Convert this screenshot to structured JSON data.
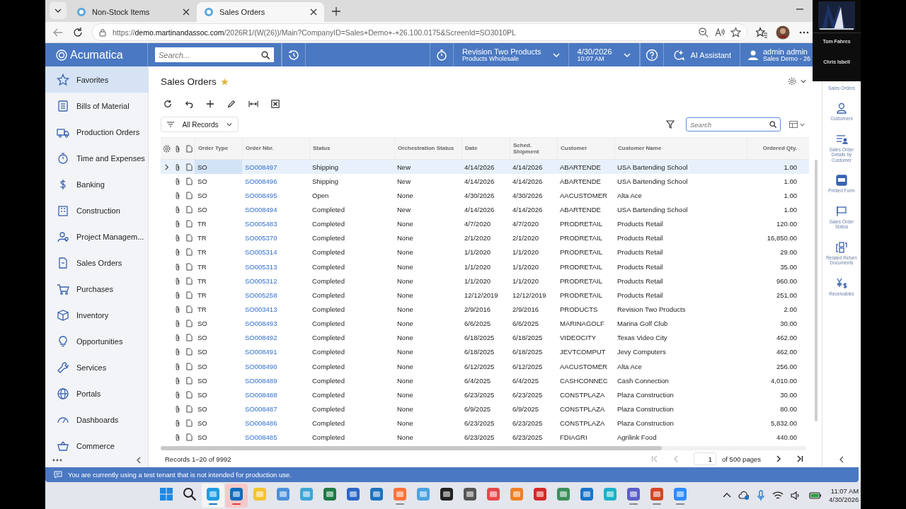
{
  "browser": {
    "tabs": [
      {
        "title": "Non-Stock Items",
        "selected": false
      },
      {
        "title": "Sales Orders",
        "selected": true
      }
    ],
    "url": "https://**demo.martinandassoc.com**/2026R1/(W(26))/Main?CompanyID=Sales+Demo+-+26.100.0175&ScreenId=SO3010PL"
  },
  "header": {
    "logo": "Acumatica",
    "search_placeholder": "Search...",
    "company": "Revision Two Products",
    "branch": "Products Wholesale",
    "date": "4/30/2026",
    "time": "10:07 AM",
    "assistant": "AI Assistant",
    "user": "admin admin",
    "tenant": "Sales Demo - 26"
  },
  "sidebar": {
    "items": [
      {
        "label": "Favorites",
        "selected": true
      },
      {
        "label": "Bills of Material",
        "selected": false
      },
      {
        "label": "Production Orders",
        "selected": false
      },
      {
        "label": "Time and Expenses",
        "selected": false
      },
      {
        "label": "Banking",
        "selected": false
      },
      {
        "label": "Construction",
        "selected": false
      },
      {
        "label": "Project Managem...",
        "selected": false
      },
      {
        "label": "Sales Orders",
        "selected": false
      },
      {
        "label": "Purchases",
        "selected": false
      },
      {
        "label": "Inventory",
        "selected": false
      },
      {
        "label": "Opportunities",
        "selected": false
      },
      {
        "label": "Services",
        "selected": false
      },
      {
        "label": "Portals",
        "selected": false
      },
      {
        "label": "Dashboards",
        "selected": false
      },
      {
        "label": "Commerce",
        "selected": false
      }
    ]
  },
  "page": {
    "title": "Sales Orders",
    "favorite": true,
    "filter": "All Records",
    "search_placeholder": "Search"
  },
  "table": {
    "columns": [
      "Order Type",
      "Order Nbr.",
      "Status",
      "Orchestration Status",
      "Date",
      "Sched. Shipment",
      "Customer",
      "Customer Name",
      "Ordered Qty."
    ],
    "rows": [
      {
        "expandable": true,
        "selected": true,
        "cells": [
          "SO",
          "SO008497",
          "Shipping",
          "New",
          "4/14/2026",
          "4/14/2026",
          "ABARTENDE",
          "USA Bartending School",
          "1.00"
        ]
      },
      {
        "expandable": false,
        "selected": false,
        "cells": [
          "SO",
          "SO008496",
          "Shipping",
          "New",
          "4/14/2026",
          "4/14/2026",
          "ABARTENDE",
          "USA Bartending School",
          "1.00"
        ]
      },
      {
        "expandable": false,
        "selected": false,
        "cells": [
          "SO",
          "SO008495",
          "Open",
          "None",
          "4/30/2026",
          "4/30/2026",
          "AACUSTOMER",
          "Alta Ace",
          "1.00"
        ]
      },
      {
        "expandable": false,
        "selected": false,
        "cells": [
          "SO",
          "SO008494",
          "Completed",
          "New",
          "4/14/2026",
          "4/14/2026",
          "ABARTENDE",
          "USA Bartending School",
          "1.00"
        ]
      },
      {
        "expandable": false,
        "selected": false,
        "cells": [
          "TR",
          "SO005483",
          "Completed",
          "None",
          "4/7/2020",
          "4/7/2020",
          "PRODRETAIL",
          "Products Retail",
          "120.00"
        ]
      },
      {
        "expandable": false,
        "selected": false,
        "cells": [
          "TR",
          "SO005370",
          "Completed",
          "None",
          "2/1/2020",
          "2/1/2020",
          "PRODRETAIL",
          "Products Retail",
          "16,850.00"
        ]
      },
      {
        "expandable": false,
        "selected": false,
        "cells": [
          "TR",
          "SO005314",
          "Completed",
          "None",
          "1/1/2020",
          "1/1/2020",
          "PRODRETAIL",
          "Products Retail",
          "29.00"
        ]
      },
      {
        "expandable": false,
        "selected": false,
        "cells": [
          "TR",
          "SO005313",
          "Completed",
          "None",
          "1/1/2020",
          "1/1/2020",
          "PRODRETAIL",
          "Products Retail",
          "35.00"
        ]
      },
      {
        "expandable": false,
        "selected": false,
        "cells": [
          "TR",
          "SO005312",
          "Completed",
          "None",
          "1/1/2020",
          "1/1/2020",
          "PRODRETAIL",
          "Products Retail",
          "960.00"
        ]
      },
      {
        "expandable": false,
        "selected": false,
        "cells": [
          "TR",
          "SO005258",
          "Completed",
          "None",
          "12/12/2019",
          "12/12/2019",
          "PRODRETAIL",
          "Products Retail",
          "251.00"
        ]
      },
      {
        "expandable": false,
        "selected": false,
        "cells": [
          "TR",
          "SO003413",
          "Completed",
          "None",
          "2/9/2016",
          "2/9/2016",
          "PRODUCTS",
          "Revision Two Products",
          "2.00"
        ]
      },
      {
        "expandable": false,
        "selected": false,
        "cells": [
          "SO",
          "SO008493",
          "Completed",
          "None",
          "6/6/2025",
          "6/6/2025",
          "MARINAGOLF",
          "Marina Golf Club",
          "30.00"
        ]
      },
      {
        "expandable": false,
        "selected": false,
        "cells": [
          "SO",
          "SO008492",
          "Completed",
          "None",
          "6/18/2025",
          "6/18/2025",
          "VIDEOCITY",
          "Texas Video City",
          "462.00"
        ]
      },
      {
        "expandable": false,
        "selected": false,
        "cells": [
          "SO",
          "SO008491",
          "Completed",
          "None",
          "6/18/2025",
          "6/18/2025",
          "JEVTCOMPUT",
          "Jevy Computers",
          "462.00"
        ]
      },
      {
        "expandable": false,
        "selected": false,
        "cells": [
          "SO",
          "SO008490",
          "Completed",
          "None",
          "6/12/2025",
          "6/12/2025",
          "AACUSTOMER",
          "Alta Ace",
          "256.00"
        ]
      },
      {
        "expandable": false,
        "selected": false,
        "cells": [
          "SO",
          "SO008489",
          "Completed",
          "None",
          "6/4/2025",
          "6/4/2025",
          "CASHCONNEC",
          "Cash Connection",
          "4,010.00"
        ]
      },
      {
        "expandable": false,
        "selected": false,
        "cells": [
          "SO",
          "SO008488",
          "Completed",
          "None",
          "6/23/2025",
          "6/23/2025",
          "CONSTPLAZA",
          "Plaza Construction",
          "30.00"
        ]
      },
      {
        "expandable": false,
        "selected": false,
        "cells": [
          "SO",
          "SO008487",
          "Completed",
          "None",
          "6/9/2025",
          "6/9/2025",
          "CONSTPLAZA",
          "Plaza Construction",
          "80.00"
        ]
      },
      {
        "expandable": false,
        "selected": false,
        "cells": [
          "SO",
          "SO008486",
          "Completed",
          "None",
          "6/23/2025",
          "6/23/2025",
          "CONSTPLAZA",
          "Plaza Construction",
          "5,832.00"
        ]
      },
      {
        "expandable": false,
        "selected": false,
        "cells": [
          "SO",
          "SO008485",
          "Completed",
          "None",
          "6/23/2025",
          "6/23/2025",
          "FDIAGRI",
          "Agrilink Food",
          "440.00"
        ]
      }
    ]
  },
  "footer": {
    "records": "Records 1–20 of 9992",
    "page": "1",
    "pages": "of 500 pages"
  },
  "related": {
    "items": [
      "Sales Orders",
      "Customers",
      "Sales Order Details by Customer",
      "Printed Form",
      "Sales Order Status",
      "Related Return Documents",
      "Receivables"
    ]
  },
  "notice": "You are currently using a test tenant that is not intended for production use.",
  "taskbar": {
    "apps": [
      {
        "kind": "windows",
        "color": "#1e88e5",
        "selected": false,
        "attention": false,
        "running": false
      },
      {
        "kind": "search",
        "color": "#222222",
        "selected": false,
        "attention": false,
        "running": false
      },
      {
        "kind": "app",
        "color": "#1b9de2",
        "selected": true,
        "attention": false,
        "running": true
      },
      {
        "kind": "app",
        "color": "#0f6cbd",
        "selected": false,
        "attention": true,
        "running": true
      },
      {
        "kind": "app",
        "color": "#f4c430",
        "selected": false,
        "attention": false,
        "running": false
      },
      {
        "kind": "app",
        "color": "#4a90d9",
        "selected": false,
        "attention": false,
        "running": false
      },
      {
        "kind": "app",
        "color": "#3ea6d8",
        "selected": false,
        "attention": false,
        "running": false
      },
      {
        "kind": "app",
        "color": "#1d7a45",
        "selected": false,
        "attention": false,
        "running": false
      },
      {
        "kind": "app",
        "color": "#2b66c8",
        "selected": false,
        "attention": false,
        "running": false
      },
      {
        "kind": "app",
        "color": "#1e73be",
        "selected": false,
        "attention": false,
        "running": false
      },
      {
        "kind": "app",
        "color": "#ff7139",
        "selected": false,
        "attention": false,
        "running": true
      },
      {
        "kind": "app",
        "color": "#4aa3df",
        "selected": false,
        "attention": false,
        "running": false
      },
      {
        "kind": "app",
        "color": "#222222",
        "selected": false,
        "attention": false,
        "running": false
      },
      {
        "kind": "app",
        "color": "#555555",
        "selected": false,
        "attention": false,
        "running": false
      },
      {
        "kind": "app",
        "color": "#e8474b",
        "selected": false,
        "attention": false,
        "running": false
      },
      {
        "kind": "app",
        "color": "#f07f22",
        "selected": false,
        "attention": false,
        "running": false
      },
      {
        "kind": "app",
        "color": "#d42a2a",
        "selected": false,
        "attention": false,
        "running": false
      },
      {
        "kind": "app",
        "color": "#3b8f5a",
        "selected": false,
        "attention": false,
        "running": false
      },
      {
        "kind": "app",
        "color": "#1a73c9",
        "selected": false,
        "attention": false,
        "running": false
      },
      {
        "kind": "app",
        "color": "#19b3c9",
        "selected": false,
        "attention": false,
        "running": false
      },
      {
        "kind": "app",
        "color": "#5b5fc7",
        "selected": false,
        "attention": false,
        "running": true
      },
      {
        "kind": "app",
        "color": "#d24726",
        "selected": false,
        "attention": false,
        "running": true
      },
      {
        "kind": "app",
        "color": "#2d8cff",
        "selected": false,
        "attention": false,
        "running": true
      }
    ],
    "time": "11:07 AM",
    "date": "4/30/2026"
  },
  "call": {
    "participants": [
      "Tom Fahres",
      "Chris Isbell"
    ]
  }
}
